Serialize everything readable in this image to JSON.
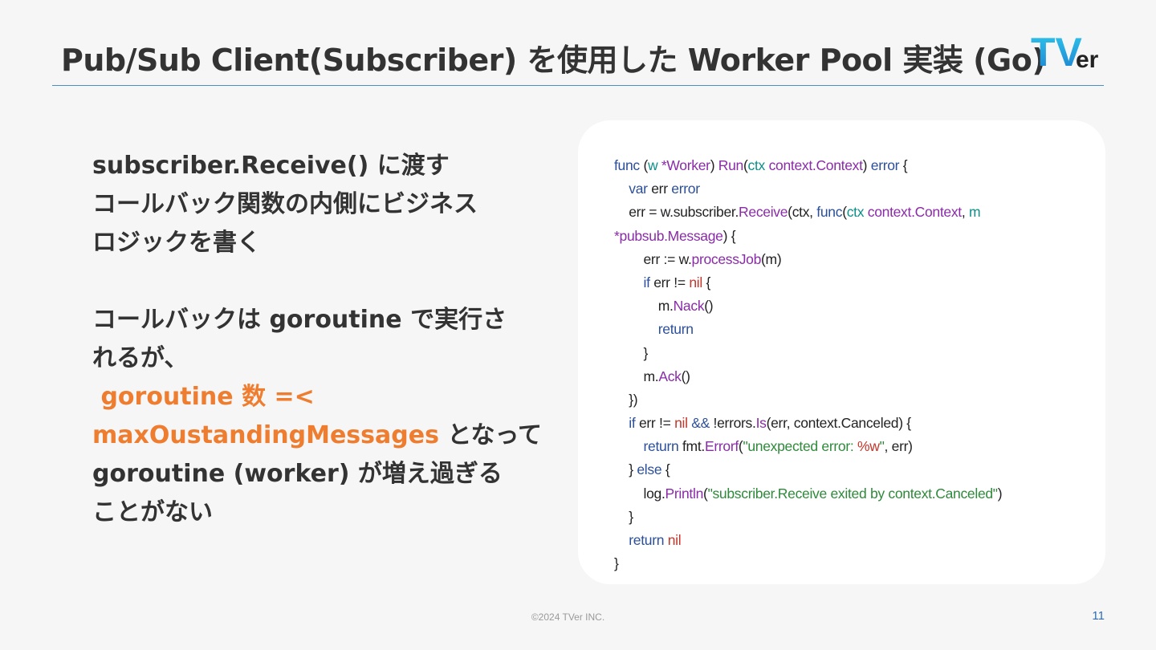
{
  "slide": {
    "title": "Pub/Sub Client(Subscriber) を使用した Worker Pool 実装 (Go)",
    "logo_text": "TVer",
    "footer": "©2024 TVer INC.",
    "page_number": "11"
  },
  "left": {
    "para1": [
      "subscriber.Receive() に渡す",
      "コールバック関数の内側にビジネス",
      "ロジックを書く"
    ],
    "para2_line1": "コールバックは goroutine で実行さ",
    "para2_line2": "れるが、",
    "hl_line1": " goroutine 数 =<",
    "hl_line2": "maxOustandingMessages",
    "after_hl": " となって",
    "para2_line5": "goroutine (worker) が増え過ぎる",
    "para2_line6": "ことがない"
  },
  "code_lines": [
    [
      [
        "kw",
        "func"
      ],
      [
        "p",
        " ("
      ],
      [
        "id",
        "w"
      ],
      [
        "p",
        " "
      ],
      [
        "fn",
        "*Worker"
      ],
      [
        "p",
        ") "
      ],
      [
        "fn",
        "Run"
      ],
      [
        "p",
        "("
      ],
      [
        "id",
        "ctx"
      ],
      [
        "p",
        " "
      ],
      [
        "fn",
        "context.Context"
      ],
      [
        "p",
        ") "
      ],
      [
        "kw",
        "error"
      ],
      [
        "p",
        " {"
      ]
    ],
    [
      [
        "p",
        "    "
      ],
      [
        "kw",
        "var"
      ],
      [
        "p",
        " err "
      ],
      [
        "kw",
        "error"
      ]
    ],
    [
      [
        "p",
        "    err = w.subscriber."
      ],
      [
        "fn",
        "Receive"
      ],
      [
        "p",
        "(ctx, "
      ],
      [
        "kw",
        "func"
      ],
      [
        "p",
        "("
      ],
      [
        "id",
        "ctx"
      ],
      [
        "p",
        " "
      ],
      [
        "fn",
        "context.Context"
      ],
      [
        "p",
        ", "
      ],
      [
        "id",
        "m"
      ]
    ],
    [
      [
        "fn",
        "*pubsub.Message"
      ],
      [
        "p",
        ") {"
      ]
    ],
    [
      [
        "p",
        "        err := w."
      ],
      [
        "fn",
        "processJob"
      ],
      [
        "p",
        "(m)"
      ]
    ],
    [
      [
        "p",
        "        "
      ],
      [
        "kw",
        "if"
      ],
      [
        "p",
        " err != "
      ],
      [
        "nl",
        "nil"
      ],
      [
        "p",
        " {"
      ]
    ],
    [
      [
        "p",
        "            m."
      ],
      [
        "fn",
        "Nack"
      ],
      [
        "p",
        "()"
      ]
    ],
    [
      [
        "p",
        "            "
      ],
      [
        "kw",
        "return"
      ]
    ],
    [
      [
        "p",
        "        }"
      ]
    ],
    [
      [
        "p",
        "        m."
      ],
      [
        "fn",
        "Ack"
      ],
      [
        "p",
        "()"
      ]
    ],
    [
      [
        "p",
        "    })"
      ]
    ],
    [
      [
        "p",
        "    "
      ],
      [
        "kw",
        "if"
      ],
      [
        "p",
        " err != "
      ],
      [
        "nl",
        "nil"
      ],
      [
        "p",
        " "
      ],
      [
        "kw",
        "&&"
      ],
      [
        "p",
        " !errors."
      ],
      [
        "fn",
        "Is"
      ],
      [
        "p",
        "(err, context.Canceled) {"
      ]
    ],
    [
      [
        "p",
        "        "
      ],
      [
        "kw",
        "return"
      ],
      [
        "p",
        " fmt."
      ],
      [
        "fn",
        "Errorf"
      ],
      [
        "p",
        "("
      ],
      [
        "st",
        "\"unexpected error: "
      ],
      [
        "nl",
        "%w"
      ],
      [
        "st",
        "\""
      ],
      [
        "p",
        ", err)"
      ]
    ],
    [
      [
        "p",
        "    } "
      ],
      [
        "kw",
        "else"
      ],
      [
        "p",
        " {"
      ]
    ],
    [
      [
        "p",
        "        log."
      ],
      [
        "fn",
        "Println"
      ],
      [
        "p",
        "("
      ],
      [
        "st",
        "\"subscriber.Receive exited by context.Canceled\""
      ],
      [
        "p",
        ")"
      ]
    ],
    [
      [
        "p",
        "    }"
      ]
    ],
    [
      [
        "p",
        "    "
      ],
      [
        "kw",
        "return"
      ],
      [
        "p",
        " "
      ],
      [
        "nl",
        "nil"
      ]
    ],
    [
      [
        "p",
        "}"
      ]
    ]
  ],
  "colors": {
    "accent_orange": "#ee7d2f",
    "rule_blue": "#4a8fc4",
    "keyword": "#2b4f9a",
    "function": "#8a2ba8",
    "identifier": "#0e8f8a",
    "nil": "#c2362b",
    "string": "#2e8a3a"
  }
}
